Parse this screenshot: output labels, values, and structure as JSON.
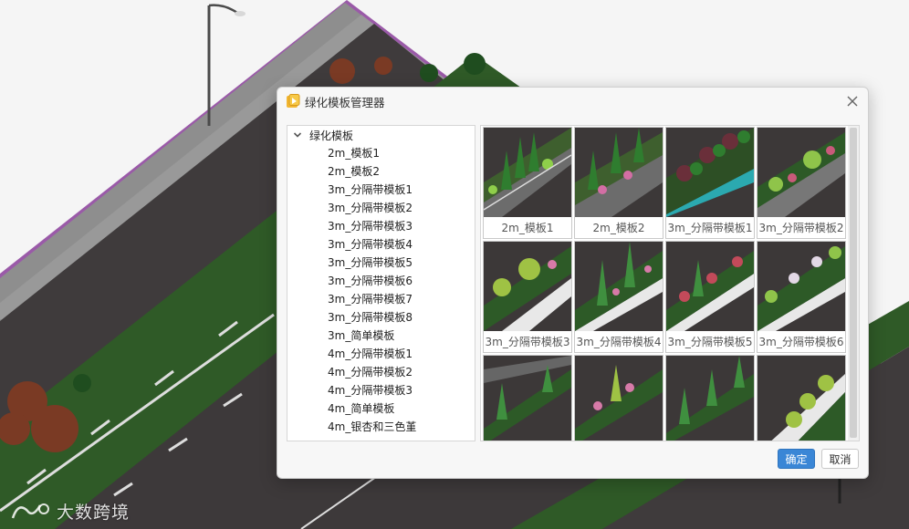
{
  "dialog": {
    "title": "绿化模板管理器",
    "ok_label": "确定",
    "cancel_label": "取消"
  },
  "tree": {
    "root_label": "绿化模板",
    "items": [
      "2m_模板1",
      "2m_模板2",
      "3m_分隔带模板1",
      "3m_分隔带模板2",
      "3m_分隔带模板3",
      "3m_分隔带模板4",
      "3m_分隔带模板5",
      "3m_分隔带模板6",
      "3m_分隔带模板7",
      "3m_分隔带模板8",
      "3m_简单模板",
      "4m_分隔带模板1",
      "4m_分隔带模板2",
      "4m_分隔带模板3",
      "4m_简单模板",
      "4m_银杏和三色堇"
    ]
  },
  "thumbnails": [
    {
      "caption": "2m_模板1"
    },
    {
      "caption": "2m_模板2"
    },
    {
      "caption": "3m_分隔带模板1"
    },
    {
      "caption": "3m_分隔带模板2"
    },
    {
      "caption": "3m_分隔带模板3"
    },
    {
      "caption": "3m_分隔带模板4"
    },
    {
      "caption": "3m_分隔带模板5"
    },
    {
      "caption": "3m_分隔带模板6"
    },
    {
      "caption": ""
    },
    {
      "caption": ""
    },
    {
      "caption": ""
    },
    {
      "caption": ""
    }
  ],
  "watermark": {
    "text": "大数跨境"
  },
  "icons": {
    "title": "template-manager-icon",
    "close": "close-icon",
    "tree_toggle": "chevron-down-icon"
  },
  "colors": {
    "accent": "#3a86d6",
    "road": "#3d3a3b",
    "grass": "#2e5a26",
    "sidewalk": "#8b8b8b",
    "lamp": "#4a4a4a"
  }
}
